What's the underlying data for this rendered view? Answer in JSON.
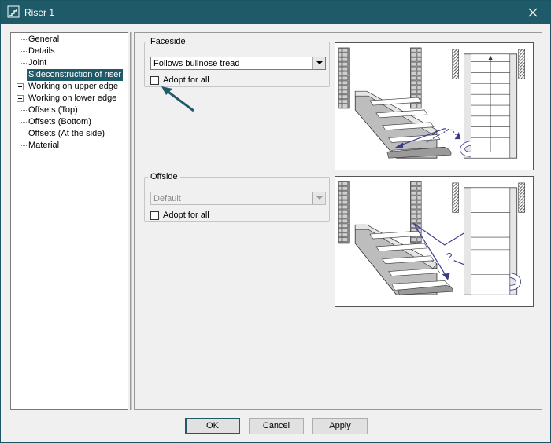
{
  "window": {
    "title": "Riser 1",
    "app_icon": "stair-app-icon",
    "close_icon": "close-icon"
  },
  "tree": {
    "items": [
      {
        "label": "General"
      },
      {
        "label": "Details"
      },
      {
        "label": "Joint"
      },
      {
        "label": "Sideconstruction of riser",
        "selected": true
      },
      {
        "label": "Working on upper edge",
        "expandable": true
      },
      {
        "label": "Working on lower edge",
        "expandable": true
      },
      {
        "label": "Offsets (Top)"
      },
      {
        "label": "Offsets (Bottom)"
      },
      {
        "label": "Offsets (At the side)"
      },
      {
        "label": "Material"
      }
    ]
  },
  "faceside": {
    "legend": "Faceside",
    "combo_value": "Follows bullnose tread",
    "adopt_label": "Adopt for all",
    "adopt_checked": false
  },
  "offside": {
    "legend": "Offside",
    "combo_value": "Default",
    "combo_disabled": true,
    "adopt_label": "Adopt for all",
    "adopt_checked": false
  },
  "illustration_bottom": {
    "question_mark": "?"
  },
  "buttons": {
    "ok": "OK",
    "cancel": "Cancel",
    "apply": "Apply"
  },
  "colors": {
    "titlebar": "#1f5a68",
    "selection": "#1f5a68",
    "annotation_arrow": "#1f5a68",
    "diagram_arrow": "#3b3b8c"
  }
}
